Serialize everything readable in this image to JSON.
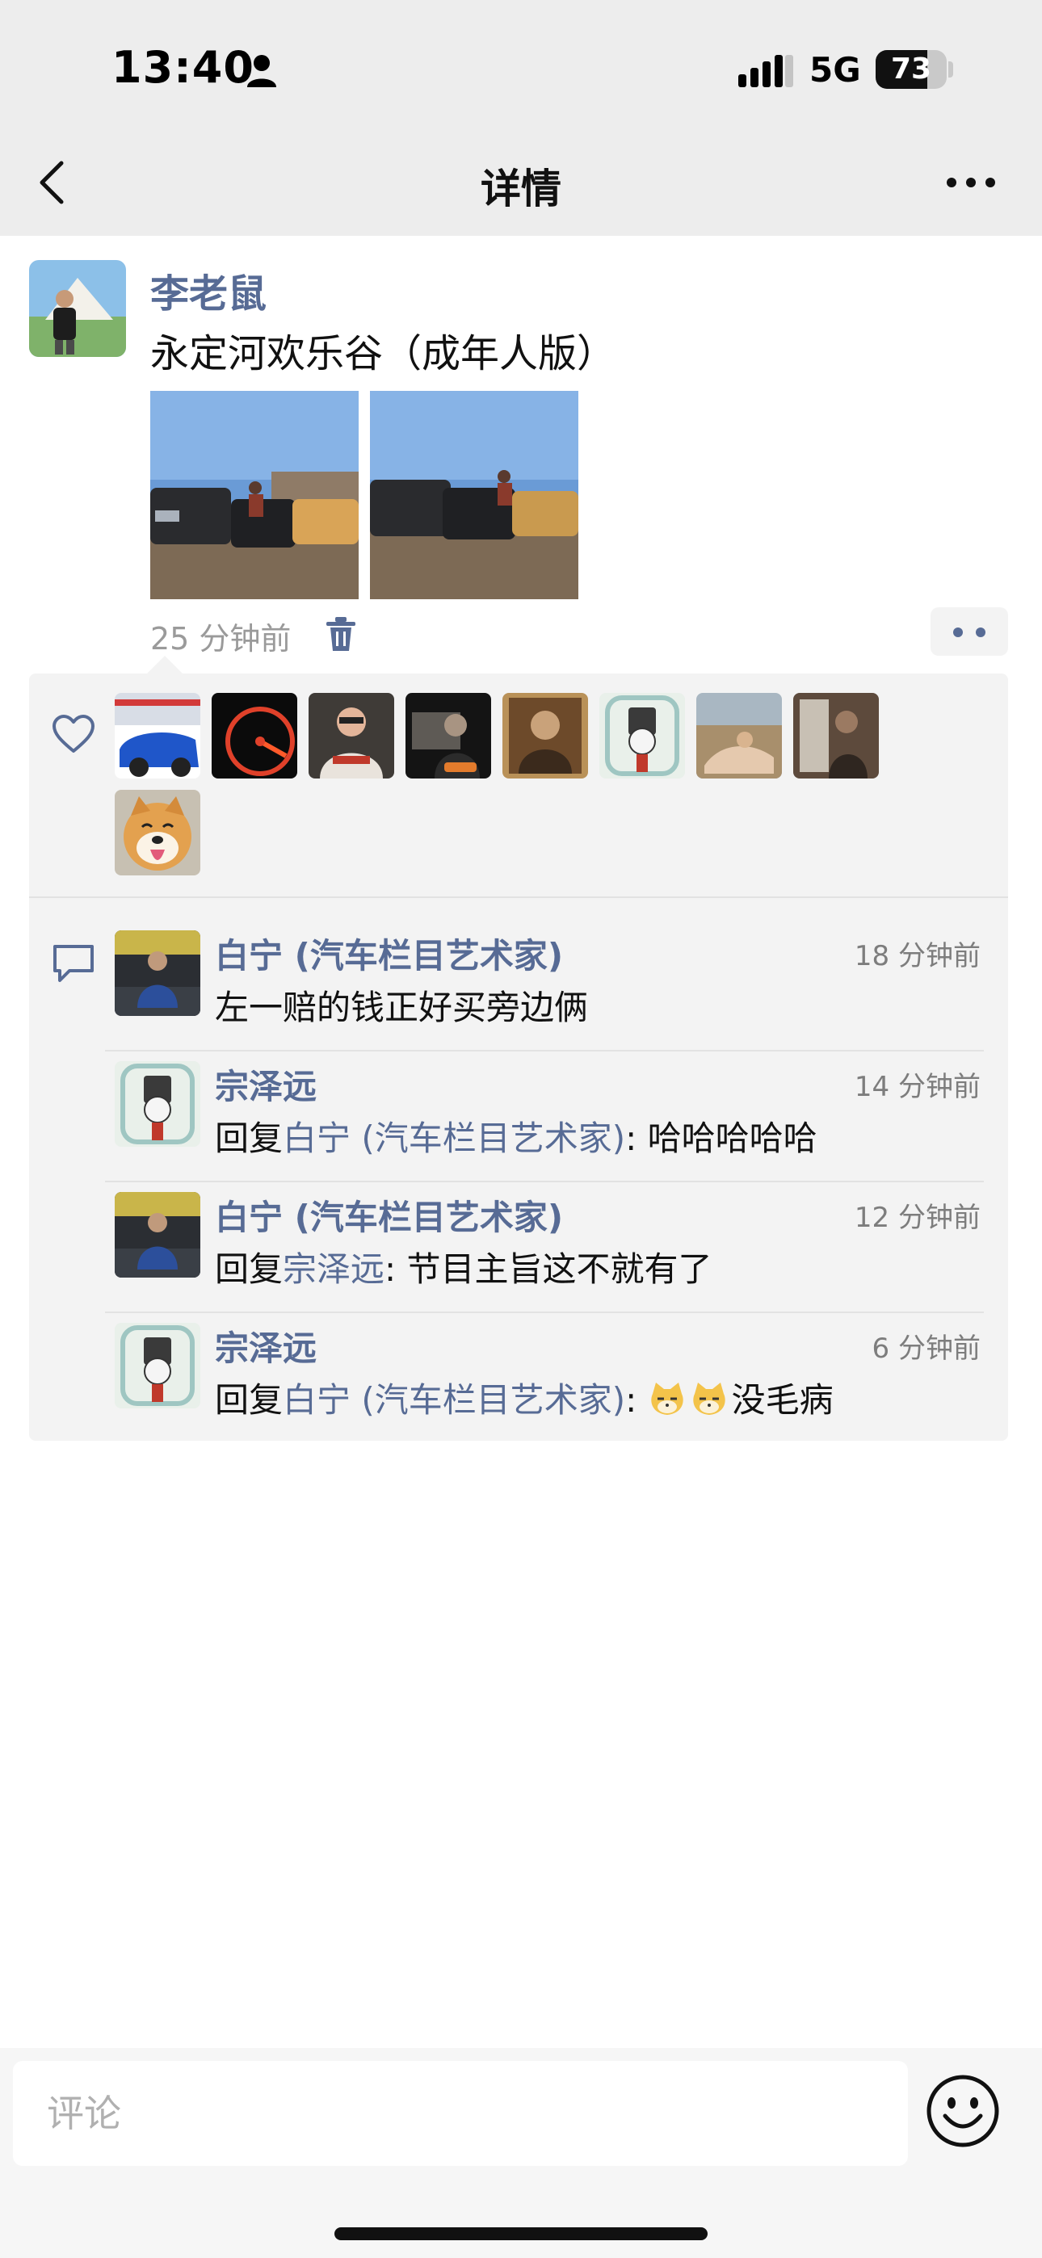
{
  "status_bar": {
    "time": "13:40",
    "network": "5G",
    "battery": "73",
    "battery_level": 0.73,
    "icons": [
      "person-icon",
      "signal-icon",
      "battery-icon"
    ]
  },
  "nav": {
    "title": "详情",
    "back_icon": "chevron-left-icon",
    "more_icon": "ellipsis-icon"
  },
  "post": {
    "author": "李老鼠",
    "text": "永定河欢乐谷（成年人版）",
    "photos": [
      "photo-1",
      "photo-2"
    ],
    "time": "25 分钟前",
    "delete_icon": "trash-icon",
    "action_icon": "two-dot-icon"
  },
  "likes": {
    "icon": "heart-outline-icon",
    "count": 9
  },
  "comments": [
    {
      "author": "白宁 (汽车栏目艺术家)",
      "time": "18 分钟前",
      "prefix": "",
      "reply_to": "",
      "sep": "",
      "text": "左一赔的钱正好买旁边俩",
      "emoji_count": 0
    },
    {
      "author": "宗泽远",
      "time": "14 分钟前",
      "prefix": "回复",
      "reply_to": "白宁 (汽车栏目艺术家)",
      "sep": ": ",
      "text": "哈哈哈哈哈",
      "emoji_count": 0
    },
    {
      "author": "白宁 (汽车栏目艺术家)",
      "time": "12 分钟前",
      "prefix": "回复",
      "reply_to": "宗泽远",
      "sep": ": ",
      "text": "节目主旨这不就有了",
      "emoji_count": 0
    },
    {
      "author": "宗泽远",
      "time": "6 分钟前",
      "prefix": "回复",
      "reply_to": "白宁 (汽车栏目艺术家)",
      "sep": ": ",
      "text": "没毛病",
      "emoji_count": 2
    }
  ],
  "input": {
    "placeholder": "评论",
    "value": "",
    "emoji_icon": "smiley-icon"
  },
  "colors": {
    "link": "#576b95",
    "panel": "#f3f3f3",
    "nav_bg": "#ededed"
  }
}
